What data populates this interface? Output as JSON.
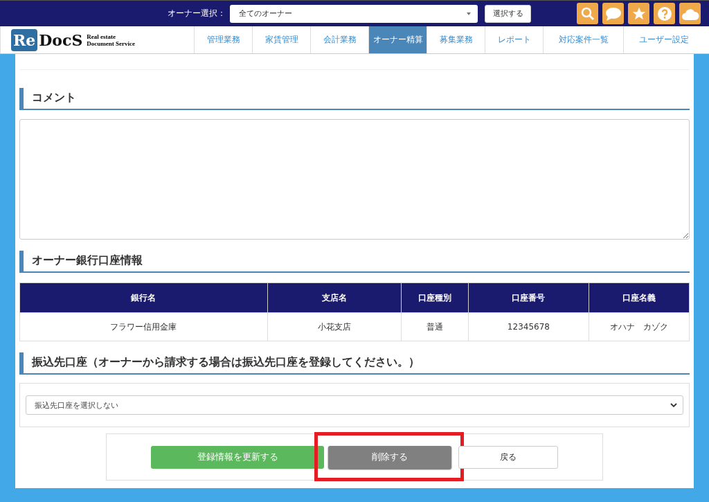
{
  "top_bar": {
    "owner_label": "オーナー選択：",
    "owner_select": "全てのオーナー",
    "select_button": "選択する"
  },
  "logo": {
    "mark": "Re",
    "name": "DocS",
    "tagline_1": "Real estate",
    "tagline_2": "Document Service"
  },
  "nav_tabs": [
    {
      "label": "管理業務",
      "selected": false
    },
    {
      "label": "家賃管理",
      "selected": false
    },
    {
      "label": "会計業務",
      "selected": false
    },
    {
      "label": "オーナー精算",
      "selected": true
    },
    {
      "label": "募集業務",
      "selected": false
    },
    {
      "label": "レポート",
      "selected": false
    },
    {
      "label": "対応案件一覧",
      "selected": false
    },
    {
      "label": "ユーザー設定",
      "selected": false
    }
  ],
  "comment_section": {
    "heading": "コメント"
  },
  "bank_section": {
    "heading": "オーナー銀行口座情報",
    "columns": [
      "銀行名",
      "支店名",
      "口座種別",
      "口座番号",
      "口座名義"
    ],
    "rows": [
      [
        "フラワー信用金庫",
        "小花支店",
        "普通",
        "12345678",
        "オハナ　カゾク"
      ]
    ]
  },
  "transfer_section": {
    "heading": "振込先口座（オーナーから請求する場合は振込先口座を登録してください。）",
    "select_value": "振込先口座を選択しない"
  },
  "buttons": [
    {
      "label": "登録情報を更新する",
      "kind": "primary",
      "highlighted": false
    },
    {
      "label": "削除する",
      "kind": "danger",
      "highlighted": true
    },
    {
      "label": "戻る",
      "kind": "plain",
      "highlighted": false
    }
  ]
}
